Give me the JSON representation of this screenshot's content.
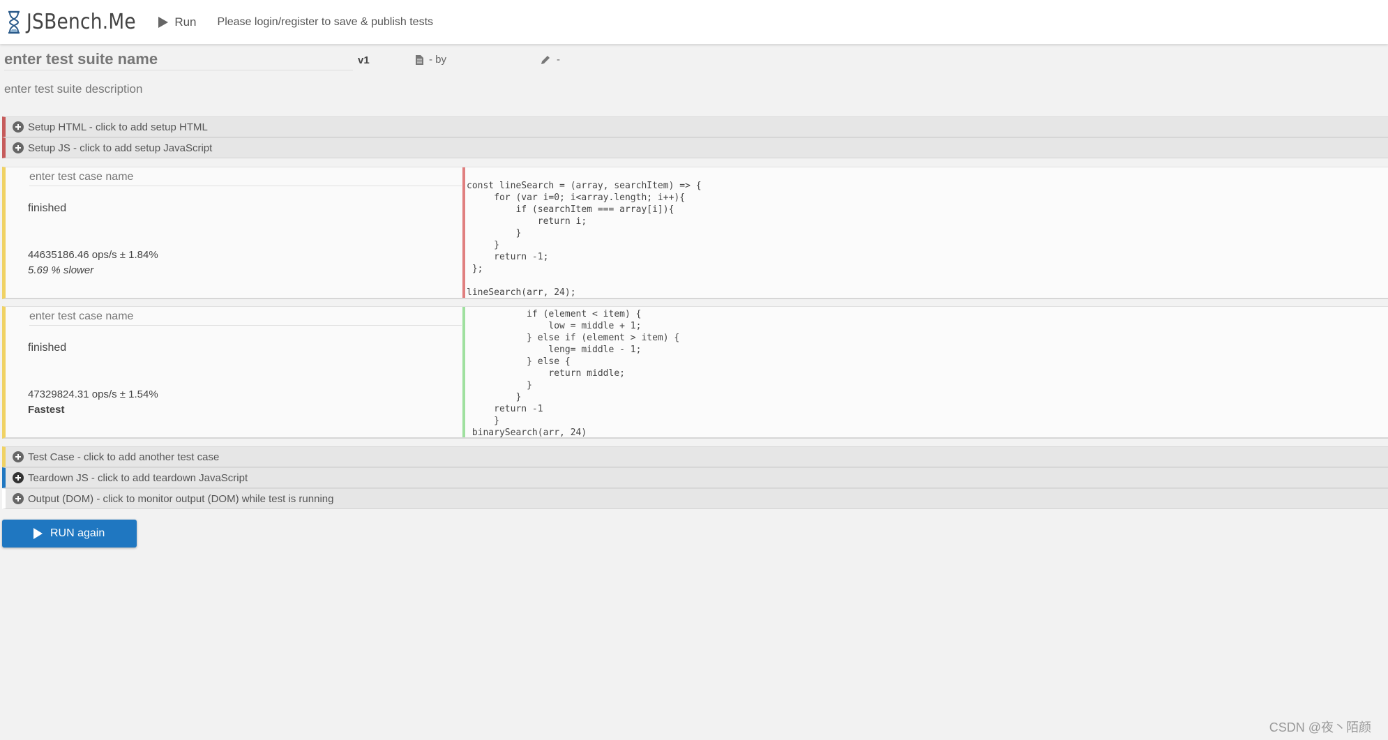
{
  "header": {
    "logo_text": "JSBench.Me",
    "run_label": "Run",
    "login_message": "Please login/register to save & publish tests"
  },
  "suite": {
    "name_placeholder": "enter test suite name",
    "version": "v1",
    "by_label": "- by",
    "edit_label": "-",
    "description_placeholder": "enter test suite description"
  },
  "sections": {
    "setup_html": "Setup HTML - click to add setup HTML",
    "setup_js": "Setup JS - click to add setup JavaScript",
    "add_test_case": "Test Case - click to add another test case",
    "teardown_js": "Teardown JS - click to add teardown JavaScript",
    "output_dom": "Output (DOM) - click to monitor output (DOM) while test is running"
  },
  "test_cases": [
    {
      "name_placeholder": "enter test case name",
      "status": "finished",
      "ops": "44635186.46 ops/s ± 1.84%",
      "relative": "5.69 % slower",
      "code": "const lineSearch = (array, searchItem) => {\n     for (var i=0; i<array.length; i++){\n         if (searchItem === array[i]){\n             return i;\n         }\n     }\n     return -1;\n };\n\nlineSearch(arr, 24);"
    },
    {
      "name_placeholder": "enter test case name",
      "status": "finished",
      "ops": "47329824.31 ops/s ± 1.54%",
      "relative": "Fastest",
      "code": "           if (element < item) {\n               low = middle + 1;\n           } else if (element > item) {\n               leng= middle - 1;\n           } else {\n               return middle;\n           }\n         }\n     return -1\n     }\n binarySearch(arr, 24)"
    }
  ],
  "run_button": {
    "label": "RUN again"
  },
  "watermark": "CSDN @夜丶陌颜",
  "colors": {
    "accent_blue": "#1f77c1",
    "setup_red": "#c65b5b",
    "case_yellow": "#f0d264",
    "code_red": "#e07f7f",
    "code_green": "#9fe09f"
  },
  "icons": {
    "logo": "hourglass-icon",
    "run": "play-icon",
    "by": "document-icon",
    "edit": "pencil-icon",
    "add": "plus-circle-icon"
  }
}
